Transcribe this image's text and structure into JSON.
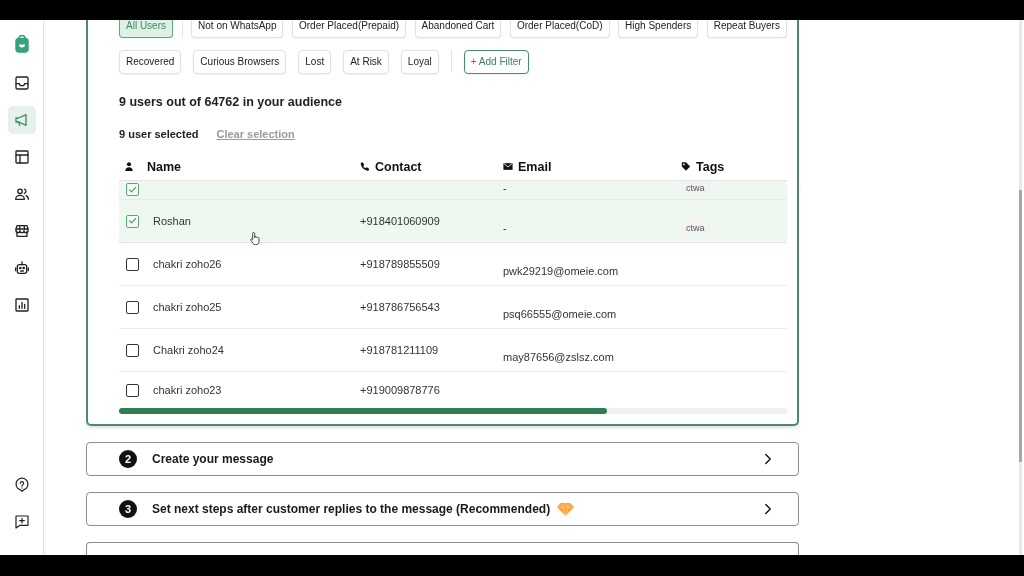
{
  "sidebar": {
    "items": [
      {
        "selected": false
      },
      {
        "selected": true
      },
      {
        "selected": false
      },
      {
        "selected": false
      },
      {
        "selected": false
      },
      {
        "selected": false
      },
      {
        "selected": false
      }
    ]
  },
  "filters": {
    "rows": [
      {
        "groups": [
          [
            {
              "label": "All Users",
              "selected": true
            }
          ],
          [
            {
              "label": "Not on WhatsApp",
              "selected": false
            },
            {
              "label": "Order Placed(Prepaid)",
              "selected": false
            },
            {
              "label": "Abandoned Cart",
              "selected": false
            },
            {
              "label": "Order Placed(CoD)",
              "selected": false
            },
            {
              "label": "High Spenders",
              "selected": false
            },
            {
              "label": "Repeat Buyers",
              "selected": false
            }
          ]
        ]
      },
      {
        "groups": [
          [
            {
              "label": "Recovered",
              "selected": false
            },
            {
              "label": "Curious Browsers",
              "selected": false
            },
            {
              "label": "Lost",
              "selected": false
            },
            {
              "label": "At Risk",
              "selected": false
            },
            {
              "label": "Loyal",
              "selected": false
            }
          ]
        ],
        "add_button": "+ Add Filter"
      }
    ]
  },
  "audience_summary": "9 users out of 64762 in your audience",
  "selection": {
    "count_label": "9 user selected",
    "clear_link": "Clear selection"
  },
  "table": {
    "columns": [
      "Name",
      "Contact",
      "Email",
      "Tags"
    ],
    "rows": [
      {
        "selected": true,
        "email": "-",
        "tags": [
          "ctwa"
        ]
      },
      {
        "selected": true,
        "name": "Roshan",
        "contact": "+918401060909",
        "email": "-",
        "tags": [
          "ctwa"
        ]
      },
      {
        "selected": false,
        "name": "chakri zoho26",
        "contact": "+918789855509",
        "email": "pwk29219@omeie.com"
      },
      {
        "selected": false,
        "name": "chakri zoho25",
        "contact": "+918786756543",
        "email": "psq66555@omeie.com"
      },
      {
        "selected": false,
        "name": "Chakri zoho24",
        "contact": "+918781211109",
        "email": "may87656@zslsz.com"
      },
      {
        "selected": false,
        "name": "chakri zoho23",
        "contact": "+919009878776"
      }
    ]
  },
  "steps": [
    {
      "number": "2",
      "title": "Create your message",
      "premium": false
    },
    {
      "number": "3",
      "title": "Set next steps after customer replies to the message (Recommended)",
      "premium": true
    }
  ]
}
